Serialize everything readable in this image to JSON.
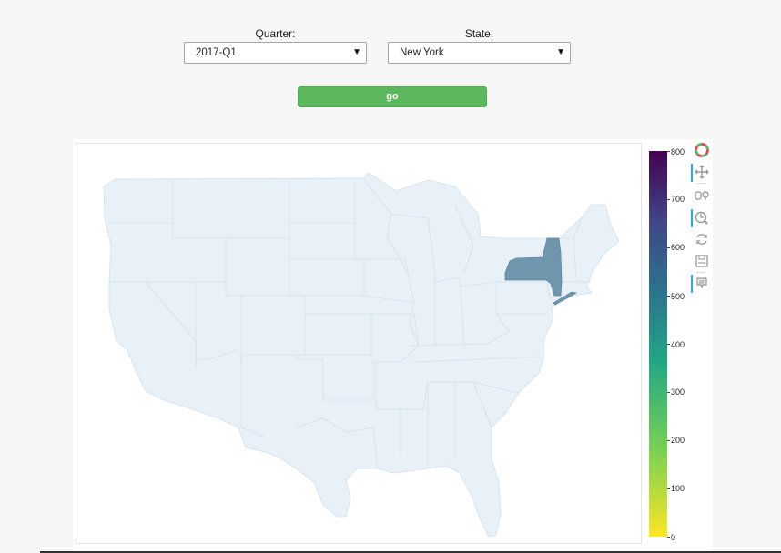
{
  "controls": {
    "quarter_label": "Quarter:",
    "quarter_value": "2017-Q1",
    "state_label": "State:",
    "state_value": "New York",
    "go_label": "go"
  },
  "map": {
    "highlighted_state": "New York",
    "base_color": "#e8f0f8",
    "highlight_color": "#7096ae",
    "border_color": "#ccdbe7"
  },
  "colorbar": {
    "palette": "viridis",
    "ticks": [
      "800",
      "700",
      "600",
      "500",
      "400",
      "300",
      "200",
      "100",
      "0"
    ]
  },
  "toolbar": {
    "logo_icon": "bokeh-logo-icon",
    "tools": [
      "pan-icon",
      "box-zoom-icon",
      "wheel-zoom-icon",
      "reset-icon",
      "save-icon",
      "hover-icon"
    ]
  }
}
